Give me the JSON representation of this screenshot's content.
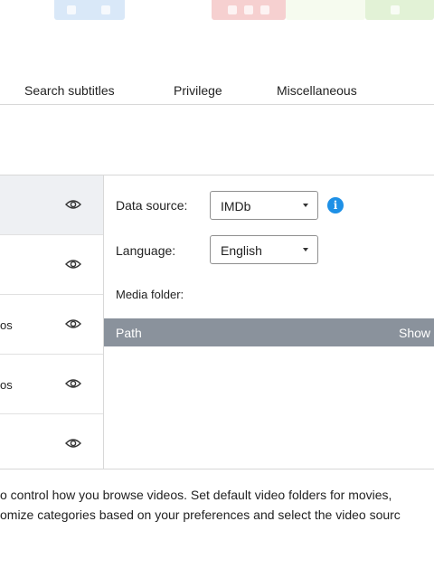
{
  "tabs": [
    "Search subtitles",
    "Privilege",
    "Miscellaneous"
  ],
  "categories": [
    {
      "label": "",
      "selected": true
    },
    {
      "label": "",
      "selected": false
    },
    {
      "label": "os",
      "selected": false
    },
    {
      "label": "os",
      "selected": false
    },
    {
      "label": "",
      "selected": false
    }
  ],
  "settings": {
    "data_source_label": "Data source:",
    "data_source_value": "IMDb",
    "info_glyph": "i",
    "language_label": "Language:",
    "language_value": "English",
    "media_folder_label": "Media folder:"
  },
  "table": {
    "col_path": "Path",
    "col_show": "Show"
  },
  "description": {
    "line1": "o control how you browse videos. Set default video folders for movies,",
    "line2": "omize categories based on your preferences and select the video sourc"
  },
  "colors": {
    "accent": "#1e90e6",
    "table_header": "#8a929c",
    "selected_row": "#eef0f3"
  }
}
